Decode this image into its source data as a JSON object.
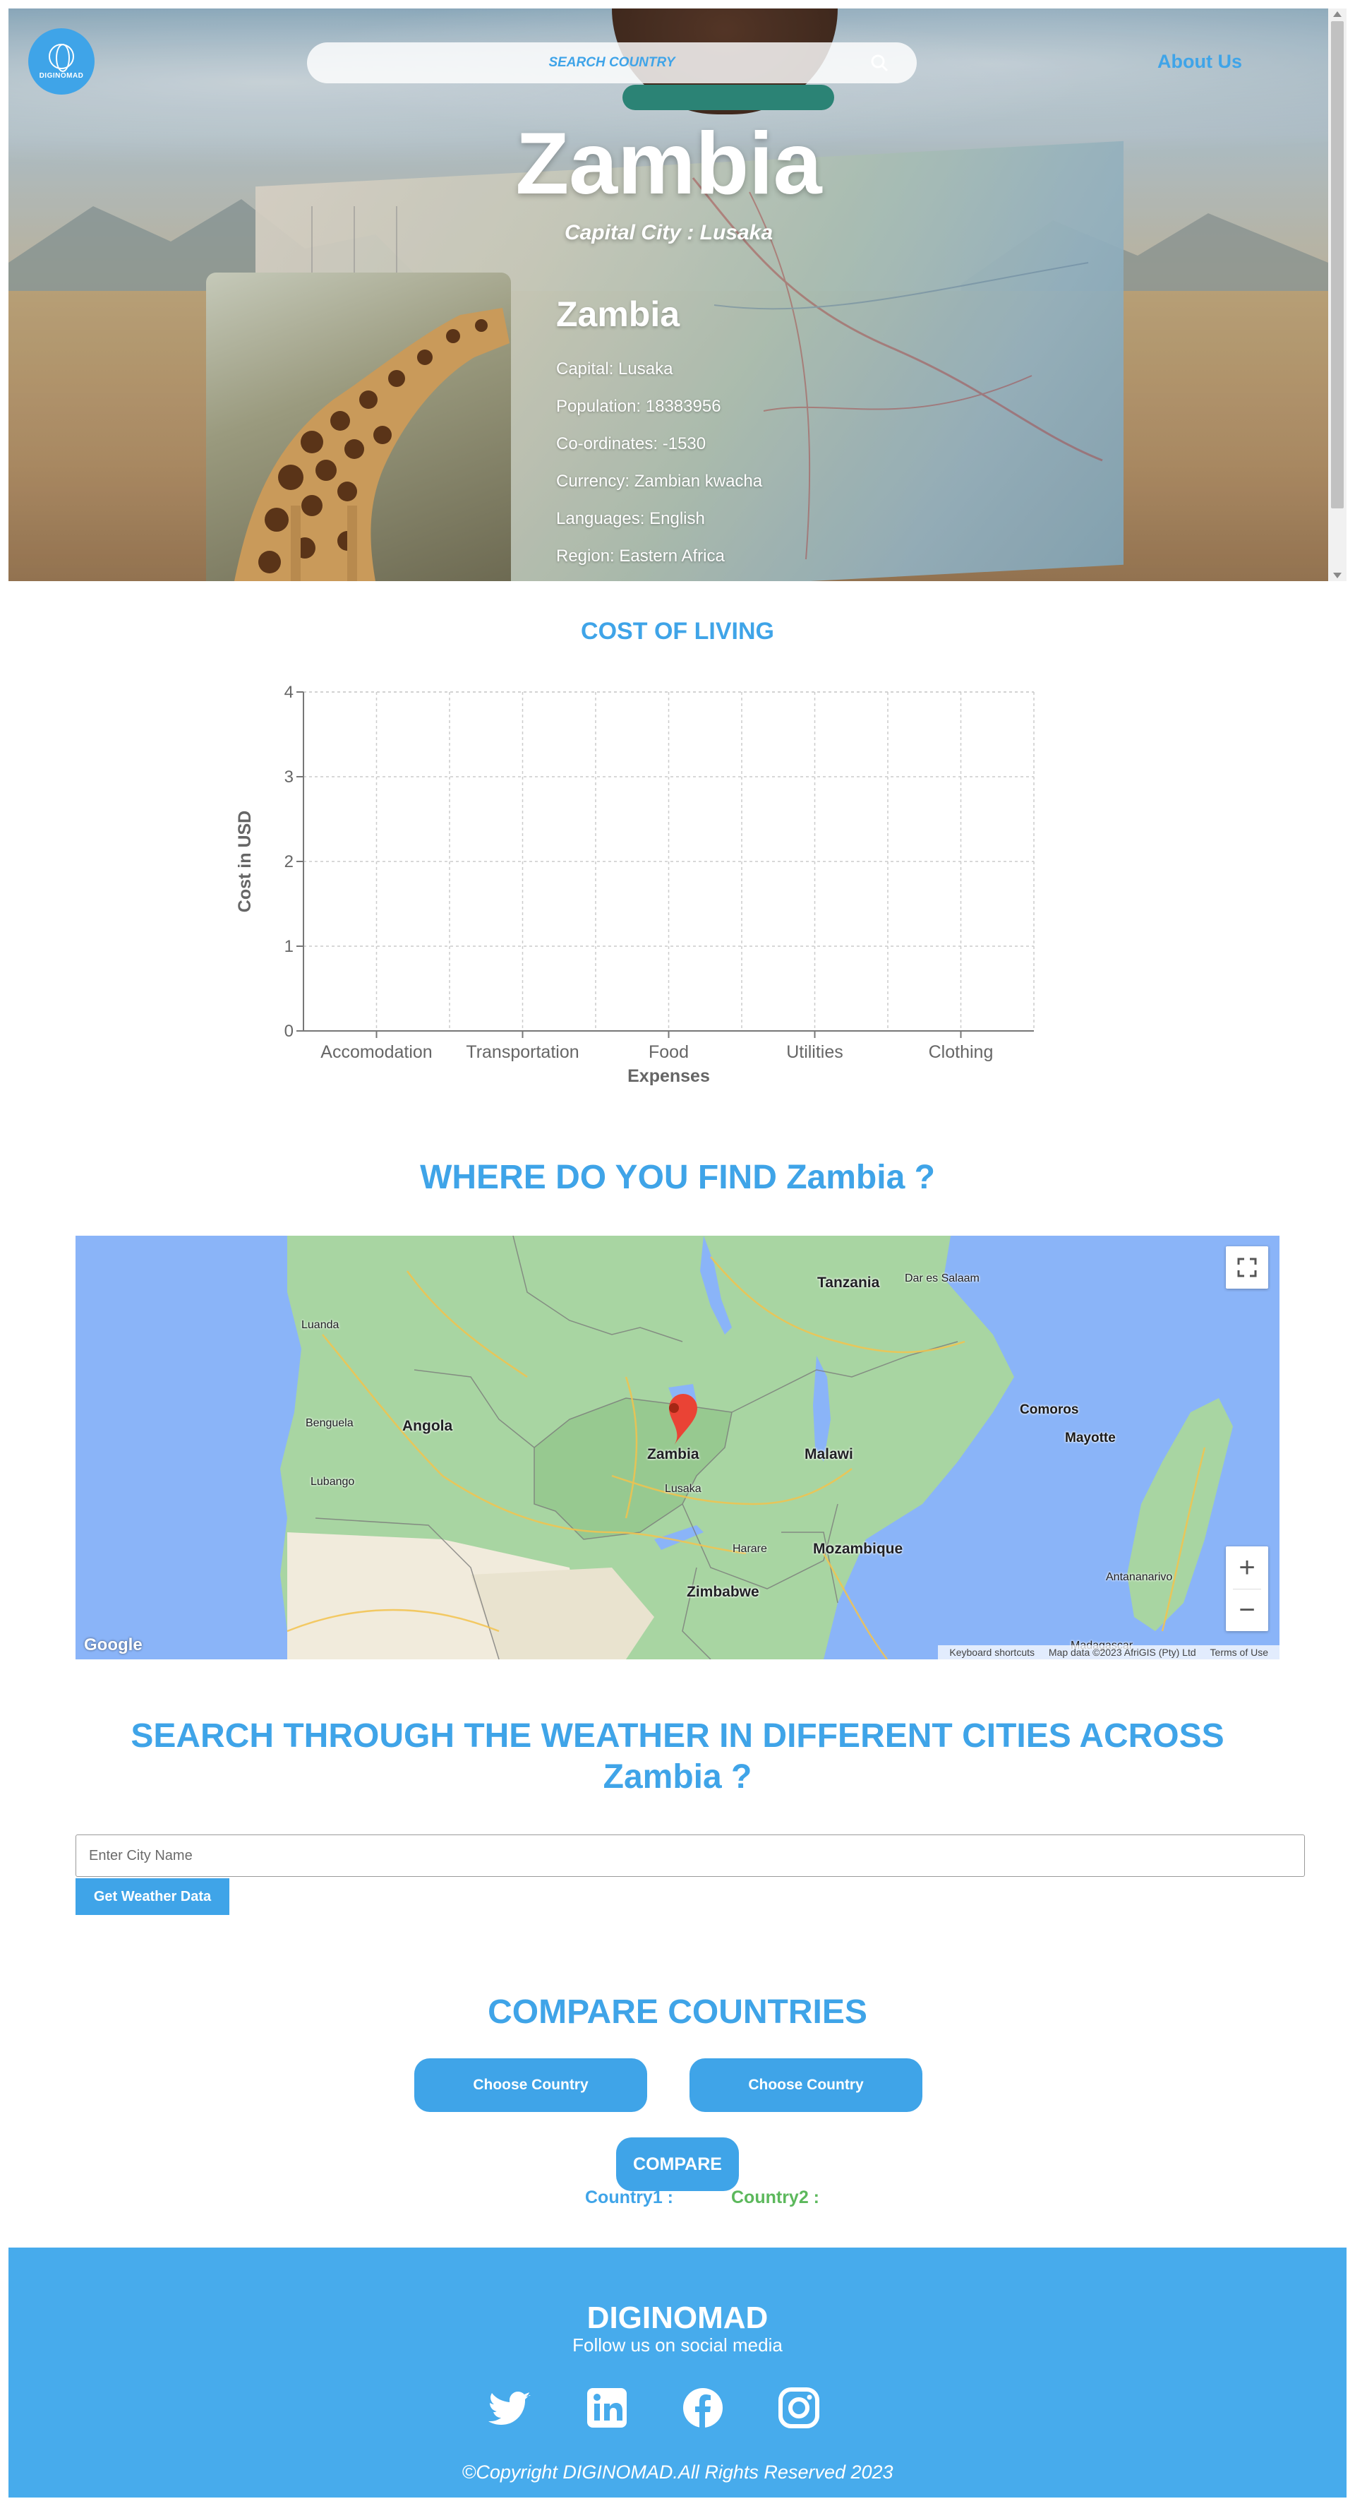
{
  "header": {
    "logo_text": "DIGINOMAD",
    "search_placeholder": "SEARCH COUNTRY",
    "about_label": "About Us"
  },
  "hero": {
    "country_title": "Zambia",
    "capital_subtitle": "Capital City : Lusaka"
  },
  "info_card": {
    "name": "Zambia",
    "capital": "Capital: Lusaka",
    "population": "Population: 18383956",
    "coordinates": "Co-ordinates: -1530",
    "currency": "Currency: Zambian kwacha",
    "languages": "Languages: English",
    "region": "Region: Eastern Africa"
  },
  "cost_of_living": {
    "heading": "COST OF LIVING"
  },
  "chart_data": {
    "type": "bar",
    "categories": [
      "Accomodation",
      "Transportation",
      "Food",
      "Utilities",
      "Clothing"
    ],
    "values": [
      0,
      0,
      0,
      0,
      0
    ],
    "xlabel": "Expenses",
    "ylabel": "Cost in USD",
    "ylim": [
      0,
      4
    ],
    "yticks": [
      0,
      1,
      2,
      3,
      4
    ],
    "grid": true,
    "colors": {
      "axis": "#777777",
      "grid": "#cccccc",
      "text": "#666666"
    }
  },
  "map_section": {
    "heading": "WHERE DO YOU FIND Zambia ?",
    "labels": {
      "tanzania": "Tanzania",
      "dar_es_salaam": "Dar es Salaam",
      "luanda": "Luanda",
      "benguela": "Benguela",
      "lubango": "Lubango",
      "angola": "Angola",
      "zambia": "Zambia",
      "malawi": "Malawi",
      "lusaka": "Lusaka",
      "harare": "Harare",
      "mozambique": "Mozambique",
      "zimbabwe": "Zimbabwe",
      "comoros": "Comoros",
      "mayotte": "Mayotte",
      "antananarivo": "Antananarivo",
      "madagascar": "Madagascar"
    },
    "google": "Google",
    "attribution": {
      "shortcuts": "Keyboard shortcuts",
      "map_data": "Map data ©2023 AfriGIS (Pty) Ltd",
      "terms": "Terms of Use"
    },
    "zoom_in": "+",
    "zoom_out": "−"
  },
  "weather": {
    "heading": "SEARCH THROUGH THE WEATHER IN DIFFERENT CITIES ACROSS Zambia ?",
    "input_placeholder": "Enter City Name",
    "button_label": "Get Weather Data"
  },
  "compare": {
    "heading": "COMPARE COUNTRIES",
    "choose1_label": "Choose Country",
    "choose2_label": "Choose Country",
    "compare_label": "COMPARE",
    "country1_label": "Country1 :",
    "country2_label": "Country2 :",
    "colors": {
      "country1": "#3fa4e8",
      "country2": "#5cb85c"
    }
  },
  "footer": {
    "brand": "DIGINOMAD",
    "follow": "Follow us on social media",
    "socials": [
      "twitter-icon",
      "linkedin-icon",
      "facebook-icon",
      "instagram-icon"
    ],
    "copyright": "©Copyright DIGINOMAD.All Rights Reserved 2023"
  },
  "theme": {
    "accent": "#3fa4e8",
    "footer_bg": "#47abec"
  }
}
